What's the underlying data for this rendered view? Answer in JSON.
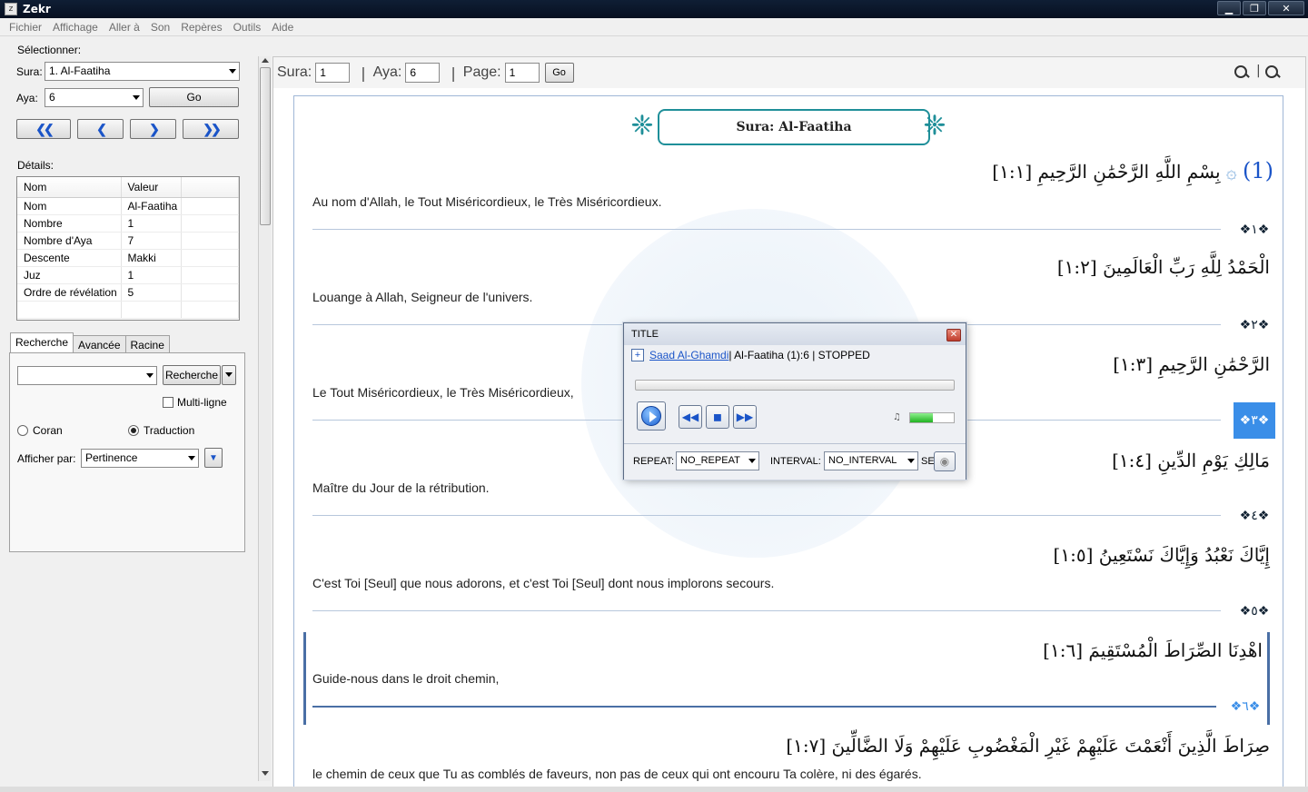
{
  "window": {
    "title": "Zekr"
  },
  "menu": [
    "Fichier",
    "Affichage",
    "Aller à",
    "Son",
    "Repères",
    "Outils",
    "Aide"
  ],
  "select": {
    "heading": "Sélectionner:",
    "sura_label": "Sura:",
    "sura_value": "1. Al-Faatiha",
    "aya_label": "Aya:",
    "aya_value": "6",
    "go_label": "Go"
  },
  "nav_buttons": [
    "first-icon",
    "prev-icon",
    "next-icon",
    "last-icon"
  ],
  "details": {
    "heading": "Détails:",
    "columns": [
      "Nom",
      "Valeur"
    ],
    "rows": [
      [
        "Nom",
        "Al-Faatiha"
      ],
      [
        "Nombre",
        "1"
      ],
      [
        "Nombre d'Aya",
        "7"
      ],
      [
        "Descente",
        "Makki"
      ],
      [
        "Juz",
        "1"
      ],
      [
        "Ordre de révélation",
        "5"
      ]
    ]
  },
  "search": {
    "tabs": [
      "Recherche",
      "Avancée",
      "Racine"
    ],
    "query": "",
    "button": "Recherche",
    "multiline": "Multi-ligne",
    "radio_coran": "Coran",
    "radio_traduction": "Traduction",
    "sort_label": "Afficher par:",
    "sort_value": "Pertinence"
  },
  "toolbar": {
    "sura_label": "Sura:",
    "sura_value": "1",
    "aya_label": "Aya:",
    "aya_value": "6",
    "page_label": "Page:",
    "page_value": "1",
    "go_label": "Go",
    "sep": "|"
  },
  "sura_header": "Sura: Al-Faatiha",
  "ayas": [
    {
      "num": "(1)",
      "ar": "بِسْمِ اللَّهِ الرَّحْمَٰنِ الرَّحِيمِ [١:١]",
      "tr": "Au nom d'Allah, le Tout Miséricordieux, le Très Miséricordieux.",
      "marker": "١"
    },
    {
      "ar": "الْحَمْدُ لِلَّهِ رَبِّ الْعَالَمِينَ [١:٢]",
      "tr": "Louange à Allah, Seigneur de l'univers.",
      "marker": "٢"
    },
    {
      "ar": "الرَّحْمَٰنِ الرَّحِيمِ [١:٣]",
      "tr": "Le Tout Miséricordieux, le Très Miséricordieux,",
      "marker": "٣"
    },
    {
      "ar": "مَالِكِ يَوْمِ الدِّينِ [١:٤]",
      "tr": "Maître du Jour de la rétribution.",
      "marker": "٤"
    },
    {
      "ar": "إِيَّاكَ نَعْبُدُ وَإِيَّاكَ نَسْتَعِينُ [١:٥]",
      "tr": "C'est Toi [Seul] que nous adorons, et c'est Toi [Seul] dont nous implorons secours.",
      "marker": "٥"
    },
    {
      "ar": "اهْدِنَا الصِّرَاطَ الْمُسْتَقِيمَ [١:٦]",
      "tr": "Guide-nous dans le droit chemin,",
      "marker": "٦"
    },
    {
      "ar": "صِرَاطَ الَّذِينَ أَنْعَمْتَ عَلَيْهِمْ غَيْرِ الْمَغْضُوبِ عَلَيْهِمْ وَلَا الضَّالِّينَ [١:٧]",
      "tr": "le chemin de ceux que Tu as comblés de faveurs, non pas de ceux qui ont encouru Ta colère, ni des égarés."
    }
  ],
  "player": {
    "title": "TITLE",
    "reciter": "Saad Al-Ghamdi",
    "status": " | Al-Faatiha (1):6 | STOPPED",
    "volume": 0.52,
    "repeat_label": "REPEAT:",
    "repeat_value": "NO_REPEAT",
    "interval_label": "INTERVAL:",
    "interval_value": "NO_INTERVAL",
    "se_label": "SE"
  },
  "colors": {
    "accent": "#1a54c8",
    "ornament": "#1f8f99",
    "selected": "#3a8ee8"
  }
}
